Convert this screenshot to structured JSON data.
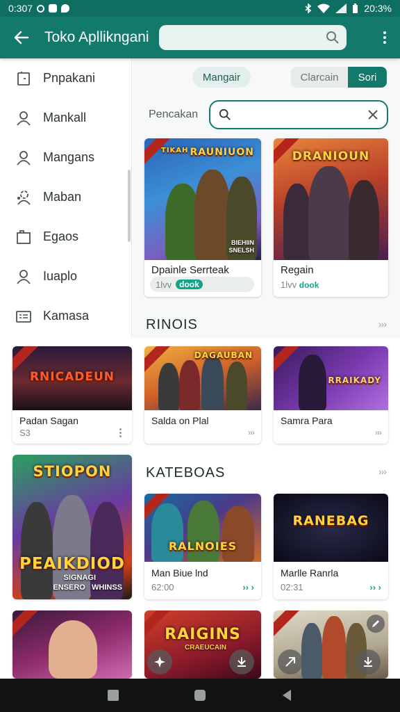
{
  "status_bar": {
    "time": "0:307",
    "battery": "20:3%"
  },
  "app_bar": {
    "title": "Toko Apllikngani"
  },
  "drawer": {
    "items": [
      {
        "label": "Pnpakani",
        "icon": "tablet-icon"
      },
      {
        "label": "Mankall",
        "icon": "person-icon"
      },
      {
        "label": "Mangans",
        "icon": "person-icon"
      },
      {
        "label": "Maban",
        "icon": "people-icon"
      },
      {
        "label": "Egaos",
        "icon": "folder-icon"
      },
      {
        "label": "Iuaplo",
        "icon": "person-icon"
      },
      {
        "label": "Kamasa",
        "icon": "list-card-icon"
      }
    ]
  },
  "panel": {
    "chip_label": "Mangair",
    "segment": {
      "option1": "Clarcain",
      "option2": "Sori"
    },
    "filter_label": "Pencakan"
  },
  "featured": [
    {
      "title": "Dpainle Serrteak",
      "thumb_title": "RAUNIUON",
      "thumb_small": "TIKAH",
      "thumb_sub": "BIEHIIN\nSNELSH",
      "price": "1lvv",
      "download": "dook"
    },
    {
      "title": "Regain",
      "thumb_title": "DRANIOUN",
      "price": "1lvv",
      "download": "dook"
    }
  ],
  "sections": {
    "section1": "RINOIS",
    "section2": "KATEBOAS"
  },
  "row1": [
    {
      "title": "Padan Sagan",
      "thumb_title": "RNICADEUN",
      "meta": "S3"
    },
    {
      "title": "Salda on Plal",
      "thumb_title": "DAGAUBAN"
    },
    {
      "title": "Samra Para",
      "thumb_title": "RRAIKADY"
    }
  ],
  "tall_card": {
    "top_title": "STIOPON",
    "bottom_title": "PEAIKDIOD",
    "sub1": "SIGNAGI",
    "sub2": "ENSERO   WHINSS"
  },
  "row2": [
    {
      "title": "Man Biue lnd",
      "thumb_title": "RALNOIES",
      "meta": "62:00"
    },
    {
      "title": "Marlle Ranrla",
      "thumb_title": "RANEBAG",
      "meta": "02:31"
    }
  ],
  "bottom_row": [
    {
      "thumb_title": ""
    },
    {
      "thumb_title": "RAIGINS",
      "thumb_sub": "CRAEUCAIN"
    },
    {
      "thumb_title": ""
    }
  ],
  "colors": {
    "primary": "#137a6b",
    "status_bar": "#0f6e62",
    "accent_green": "#13a38c"
  }
}
